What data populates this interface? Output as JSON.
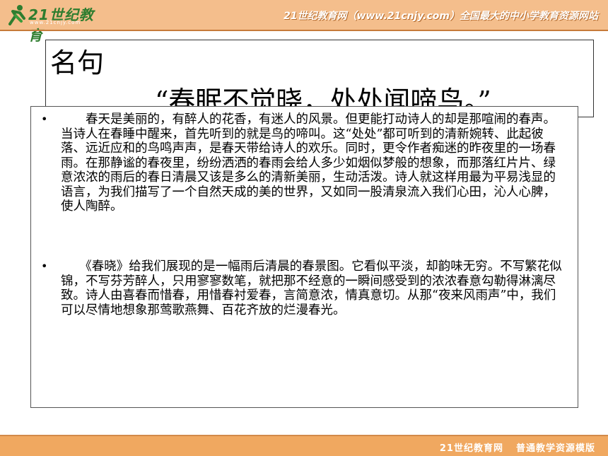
{
  "header": {
    "logo_text": "21世纪教育",
    "logo_url": "www.21cnjy.com",
    "tagline": "21世纪教育网（www.21cnjy.com）全国最大的中小学教育资源网站"
  },
  "title": {
    "heading": "名句",
    "quote": "“春眠不觉晓，处处闻啼鸟。”"
  },
  "content": {
    "bullets": [
      "•",
      "•"
    ],
    "paragraphs": [
      "　　春天是美丽的，有醉人的花香，有迷人的风景。但更能打动诗人的却是那喧闹的春声。当诗人在春睡中醒来，首先听到的就是鸟的啼叫。这“处处”都可听到的清新婉转、此起彼落、远近应和的鸟鸣声声，是春天带给诗人的欢乐。同时，更令作者痴迷的昨夜里的一场春雨。在那静谧的春夜里，纷纷洒洒的春雨会给人多少如烟似梦般的想象，而那落红片片、绿意浓浓的雨后的春日清晨又该是多么的清新美丽，生动活泼。诗人就这样用最为平易浅显的语言，为我们描写了一个自然天成的美的世界，又如同一股清泉流入我们心田，沁人心脾，使人陶醉。",
      "　　《春晓》给我们展现的是一幅雨后清晨的春景图。它看似平淡，却韵味无穷。不写繁花似锦，不写芬芳醉人，只用寥寥数笔，就把那不经意的一瞬间感受到的浓浓春意勾勒得淋漓尽致。诗人由喜春而惜春，用惜春衬爱春，言简意浓，情真意切。从那“夜来风雨声”中，我们可以尽情地想象那莺歌燕舞、百花齐放的烂漫春光。"
    ]
  },
  "footer": {
    "site": "21世纪教育网",
    "label": "普通教学资源模版"
  },
  "colors": {
    "header_bg": "#f4be8c",
    "footer_bg": "#f0a860",
    "logo_green": "#2f7d2f"
  }
}
